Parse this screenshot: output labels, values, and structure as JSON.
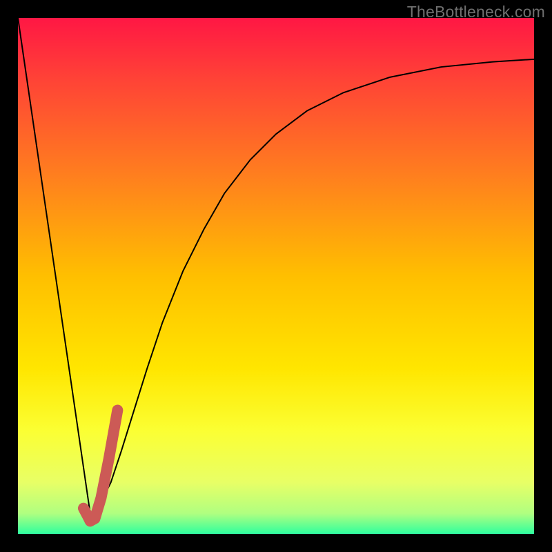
{
  "watermark": "TheBottleneck.com",
  "chart_data": {
    "type": "line",
    "title": "",
    "xlabel": "",
    "ylabel": "",
    "xlim": [
      0,
      100
    ],
    "ylim": [
      0,
      100
    ],
    "grid": false,
    "legend": false,
    "background": {
      "type": "vertical_gradient",
      "stops": [
        {
          "pos": 0.0,
          "color": "#ff1744"
        },
        {
          "pos": 0.12,
          "color": "#ff4336"
        },
        {
          "pos": 0.3,
          "color": "#ff7d1f"
        },
        {
          "pos": 0.5,
          "color": "#ffbf00"
        },
        {
          "pos": 0.68,
          "color": "#ffe600"
        },
        {
          "pos": 0.8,
          "color": "#fbff33"
        },
        {
          "pos": 0.9,
          "color": "#e8ff66"
        },
        {
          "pos": 0.96,
          "color": "#b0ff80"
        },
        {
          "pos": 1.0,
          "color": "#2eff9e"
        }
      ]
    },
    "series": [
      {
        "name": "left-descent",
        "stroke": "#000000",
        "stroke_width": 2,
        "x": [
          0.0,
          14.0
        ],
        "y": [
          100.0,
          4.0
        ]
      },
      {
        "name": "right-curve",
        "stroke": "#000000",
        "stroke_width": 2,
        "x": [
          14.0,
          16.0,
          18.0,
          20.0,
          22.5,
          25.0,
          28.0,
          32.0,
          36.0,
          40.0,
          45.0,
          50.0,
          56.0,
          63.0,
          72.0,
          82.0,
          92.0,
          100.0
        ],
        "y": [
          4.0,
          6.0,
          10.0,
          16.0,
          24.0,
          32.0,
          41.0,
          51.0,
          59.0,
          66.0,
          72.5,
          77.5,
          82.0,
          85.5,
          88.5,
          90.5,
          91.5,
          92.0
        ]
      },
      {
        "name": "j-glyph",
        "stroke": "#cc5a56",
        "stroke_width": 16,
        "linecap": "round",
        "x": [
          19.3,
          17.6,
          16.1,
          14.9,
          14.0,
          13.5,
          12.7
        ],
        "y": [
          24.0,
          14.5,
          7.0,
          3.0,
          2.5,
          3.5,
          5.0
        ]
      }
    ],
    "annotations": []
  }
}
